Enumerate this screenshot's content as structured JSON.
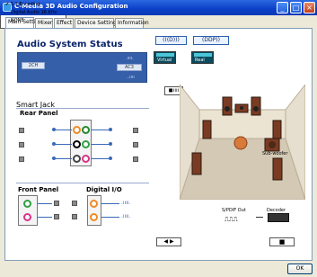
{
  "window": {
    "title": "C-Media 3D Audio Configuration"
  },
  "tabs": [
    "Main Setting",
    "Mixer",
    "Effect",
    "Device Setting",
    "Information"
  ],
  "audio_status": {
    "title": "Audio System Status",
    "lcd_left": "2CH",
    "lcd_right": "AC3"
  },
  "top_buttons": {
    "dolby": "(((D)))",
    "ddp": "(DDP))"
  },
  "mode_buttons": {
    "virtual": "Virtual",
    "real": "Real"
  },
  "smart_jack": {
    "title": "Smart Jack",
    "rear_panel": "Rear Panel"
  },
  "front_panel": "Front Panel",
  "digital_io": "Digital I/O",
  "speaker_labels": {
    "subwoofer": "Sub-woofer"
  },
  "output_chain": {
    "spdif_out": "S/PDIF Out",
    "decoder": "Decoder"
  },
  "popup_menu": [
    "5.1 Encoding",
    "Digital Audio 16 KHz",
    "NONE"
  ],
  "ok_button": "OK",
  "colors": {
    "titlebar": "#0a3fc6",
    "lcd": "#355fa8",
    "jack_green": "#2ea043",
    "jack_pink": "#d6338a",
    "jack_orange": "#f08a24",
    "floor": "#d4c9b5"
  }
}
